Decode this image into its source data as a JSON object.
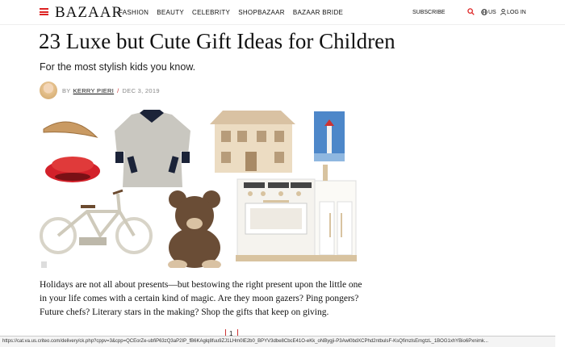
{
  "nav": {
    "logo": "BAZAAR",
    "links": [
      "FASHION",
      "BEAUTY",
      "CELEBRITY",
      "SHOPBAZAAR",
      "BAZAAR BRIDE"
    ],
    "subscribe": "SUBSCRIBE",
    "region": "US",
    "login": "LOG IN",
    "accent_color": "#d22222"
  },
  "article": {
    "title": "23 Luxe but Cute Gift Ideas for Children",
    "subtitle": "For the most stylish kids you know.",
    "by_prefix": "BY",
    "author": "KERRY PIERI",
    "date": "DEC 3, 2019",
    "body": "Holidays are not all about presents—but bestowing the right present upon the little one in your life comes with a certain kind of magic. Are they moon gazers? Ping pongers? Future chefs? Literary stars in the making? Shop the gifts that keep on giving."
  },
  "page_indicator": "1",
  "status_url": "https://cat.va.us.criteo.com/delivery/ck.php?cppv=3&cpp=QCEorZe-ubfiP63zQ3aP2IP_fB6KAglq8fuu9ZJ1LHm0lE2b0_BPYV3dbe8CbcE41O-eKk_oNBygji-P3Awl0bdXCPhd2ntbulsF-KsQfimzlsEmgtzL_1BOG1xhYBio6Pxnimk..."
}
